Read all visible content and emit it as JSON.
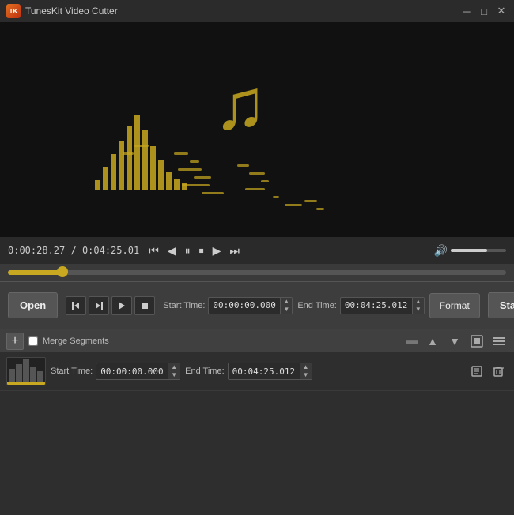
{
  "titleBar": {
    "title": "TunesKit Video Cutter",
    "iconLabel": "TK",
    "minimizeLabel": "─",
    "maximizeLabel": "□",
    "closeLabel": "✕"
  },
  "playback": {
    "currentTime": "0:00:28.27",
    "totalTime": "0:04:25.01",
    "timeSeparator": " / ",
    "controls": {
      "rewindStep": "⏮",
      "stepBack": "◀",
      "pause": "⏸",
      "stop": "⏹",
      "play": "▶",
      "fastForward": "⏭"
    }
  },
  "clipControls": {
    "openLabel": "Open",
    "startTimeLabel": "Start Time:",
    "startTimeValue": "00:00:00.000",
    "endTimeLabel": "End Time:",
    "endTimeValue": "00:04:25.012",
    "formatLabel": "Format",
    "startLabel": "Start",
    "clipIcons": {
      "markIn": "[",
      "markOut": "]",
      "preview": "▶",
      "stop": "■"
    }
  },
  "segmentsHeader": {
    "addLabel": "+",
    "mergeLabel": "Merge Segments",
    "upLabel": "▲",
    "downLabel": "▼",
    "outputLabel": "⊞",
    "listLabel": "≡"
  },
  "segments": [
    {
      "id": 1,
      "startTimeLabel": "Start Time:",
      "startTimeValue": "00:00:00.000",
      "endTimeLabel": "End Time:",
      "endTimeValue": "00:04:25.012"
    }
  ],
  "colors": {
    "accent": "#c8a820",
    "bg": "#3a3a3a",
    "darkBg": "#2b2b2b",
    "controlBg": "#3d3d3d"
  }
}
